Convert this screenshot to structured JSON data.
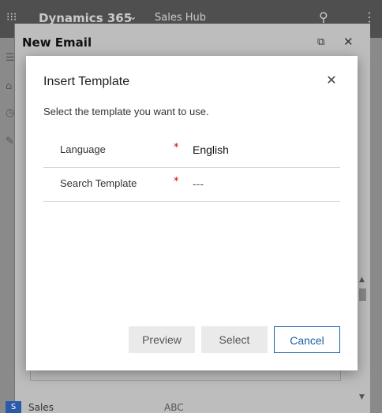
{
  "app": {
    "brand": "Dynamics 365",
    "hub": "Sales Hub"
  },
  "email_window": {
    "title": "New Email"
  },
  "background": {
    "sales_badge": "S",
    "sales_label": "Sales",
    "abc_value": "ABC"
  },
  "dialog": {
    "title": "Insert Template",
    "description": "Select the template you want to use.",
    "fields": [
      {
        "label": "Language",
        "required_mark": "*",
        "value": "English"
      },
      {
        "label": "Search Template",
        "required_mark": "*",
        "value": "---"
      }
    ],
    "buttons": {
      "preview": "Preview",
      "select": "Select",
      "cancel": "Cancel"
    }
  },
  "colors": {
    "accent": "#1a5fa8",
    "required": "#cc0000",
    "disabled_button_bg": "#eaeaea"
  }
}
